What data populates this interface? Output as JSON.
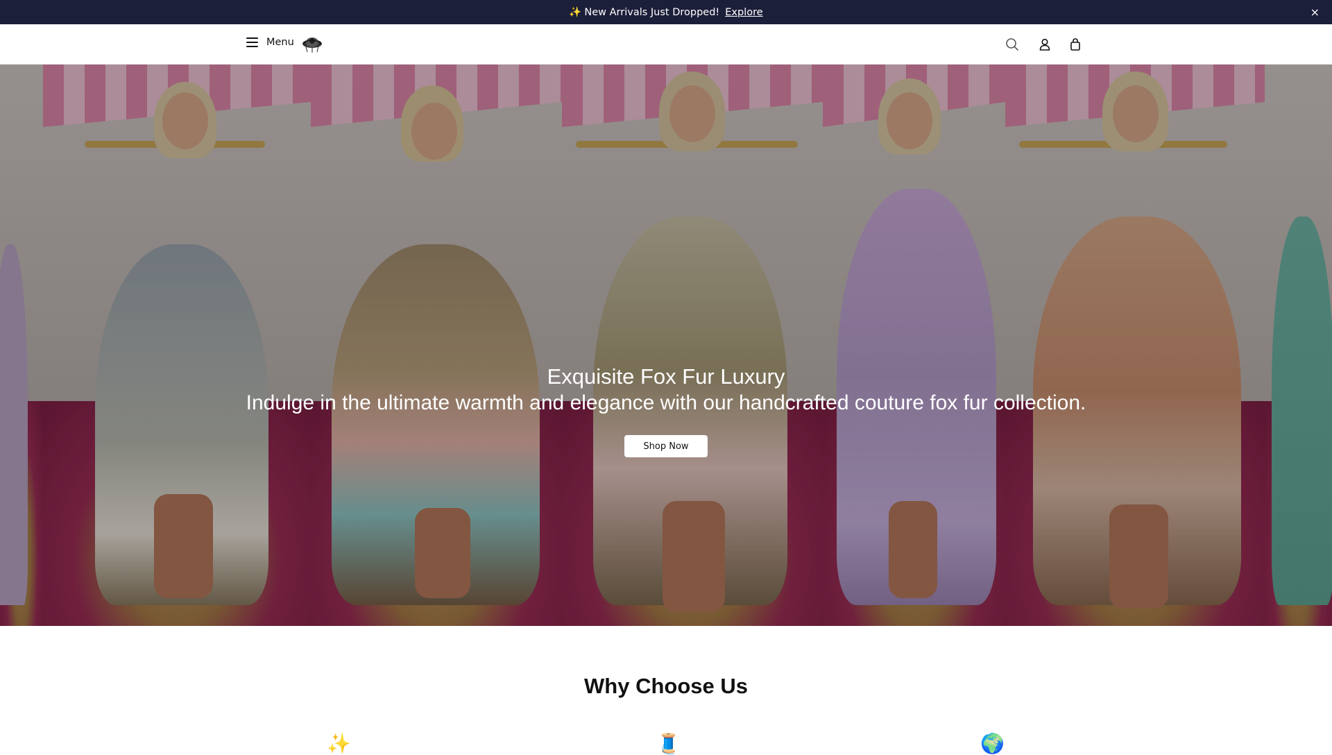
{
  "announcement": {
    "emoji": "✨",
    "message": "New Arrivals Just Dropped!",
    "link_label": "Explore",
    "close_glyph": "×"
  },
  "header": {
    "menu_label": "Menu",
    "icons": [
      "search-icon",
      "account-icon",
      "cart-icon"
    ]
  },
  "hero": {
    "title": "Exquisite Fox Fur Luxury",
    "subtitle": "Indulge in the ultimate warmth and elegance with our handcrafted couture fox fur collection.",
    "button_label": "Shop Now"
  },
  "why": {
    "title": "Why Choose Us",
    "features": [
      {
        "icon": "✨"
      },
      {
        "icon": "🧵"
      },
      {
        "icon": "🌍"
      }
    ]
  },
  "colors": {
    "announcement_bg": "#1c1f3a",
    "header_bg": "#ffffff",
    "button_bg": "#ffffff"
  }
}
